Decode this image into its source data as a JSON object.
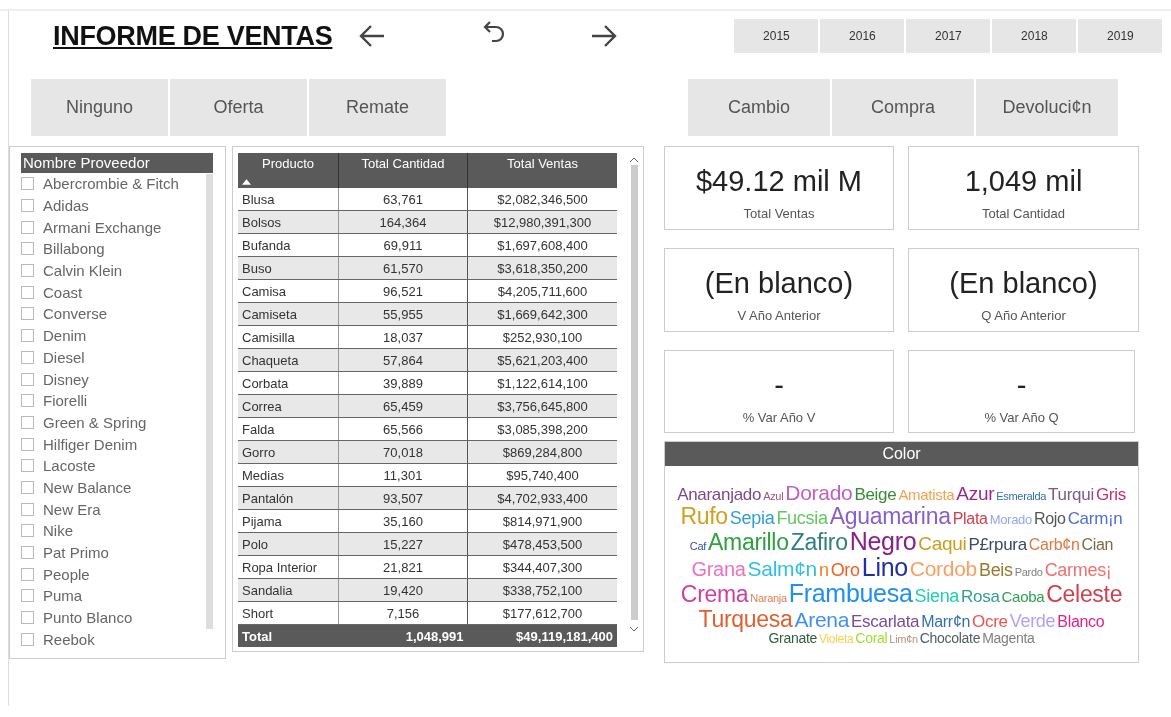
{
  "title": "INFORME DE VENTAS",
  "years": [
    {
      "label": "2015",
      "selected": false
    },
    {
      "label": "2016",
      "selected": false
    },
    {
      "label": "2017",
      "selected": false
    },
    {
      "label": "2018",
      "selected": false
    },
    {
      "label": "2019",
      "selected": false
    }
  ],
  "promo_buttons": [
    {
      "label": "Ninguno",
      "selected": false
    },
    {
      "label": "Oferta",
      "selected": false
    },
    {
      "label": "Remate",
      "selected": false
    }
  ],
  "type_buttons": [
    {
      "label": "Cambio",
      "selected": false
    },
    {
      "label": "Compra",
      "selected": false
    },
    {
      "label": "Devoluci¢n",
      "selected": false
    }
  ],
  "supplier_slicer": {
    "title": "Nombre Proveedor",
    "items": [
      {
        "label": "Abercrombie & Fitch",
        "checked": false
      },
      {
        "label": "Adidas",
        "checked": false
      },
      {
        "label": "Armani Exchange",
        "checked": false
      },
      {
        "label": "Billabong",
        "checked": false
      },
      {
        "label": "Calvin Klein",
        "checked": false
      },
      {
        "label": "Coast",
        "checked": false
      },
      {
        "label": "Converse",
        "checked": false
      },
      {
        "label": "Denim",
        "checked": false
      },
      {
        "label": "Diesel",
        "checked": false
      },
      {
        "label": "Disney",
        "checked": false
      },
      {
        "label": "Fiorelli",
        "checked": false
      },
      {
        "label": "Green & Spring",
        "checked": false
      },
      {
        "label": "Hilfiger Denim",
        "checked": false
      },
      {
        "label": "Lacoste",
        "checked": false
      },
      {
        "label": "New Balance",
        "checked": false
      },
      {
        "label": "New Era",
        "checked": false
      },
      {
        "label": "Nike",
        "checked": false
      },
      {
        "label": "Pat Primo",
        "checked": false
      },
      {
        "label": "People",
        "checked": false
      },
      {
        "label": "Puma",
        "checked": false
      },
      {
        "label": "Punto Blanco",
        "checked": false
      },
      {
        "label": "Reebok",
        "checked": false
      }
    ]
  },
  "table": {
    "columns": [
      "Producto",
      "Total Cantidad",
      "Total Ventas"
    ],
    "rows": [
      [
        "Blusa",
        "63,761",
        "$2,082,346,500"
      ],
      [
        "Bolsos",
        "164,364",
        "$12,980,391,300"
      ],
      [
        "Bufanda",
        "69,911",
        "$1,697,608,400"
      ],
      [
        "Buso",
        "61,570",
        "$3,618,350,200"
      ],
      [
        "Camisa",
        "96,521",
        "$4,205,711,600"
      ],
      [
        "Camiseta",
        "55,955",
        "$1,669,642,300"
      ],
      [
        "Camisilla",
        "18,037",
        "$252,930,100"
      ],
      [
        "Chaqueta",
        "57,864",
        "$5,621,203,400"
      ],
      [
        "Corbata",
        "39,889",
        "$1,122,614,100"
      ],
      [
        "Correa",
        "65,459",
        "$3,756,645,800"
      ],
      [
        "Falda",
        "65,566",
        "$3,085,398,200"
      ],
      [
        "Gorro",
        "70,018",
        "$869,284,800"
      ],
      [
        "Medias",
        "11,301",
        "$95,740,400"
      ],
      [
        "Pantalón",
        "93,507",
        "$4,702,933,400"
      ],
      [
        "Pijama",
        "35,160",
        "$814,971,900"
      ],
      [
        "Polo",
        "15,227",
        "$478,453,500"
      ],
      [
        "Ropa Interior",
        "21,821",
        "$344,407,300"
      ],
      [
        "Sandalia",
        "19,420",
        "$338,752,100"
      ],
      [
        "Short",
        "7,156",
        "$177,612,700"
      ]
    ],
    "total": [
      "Total",
      "1,048,991",
      "$49,119,181,400"
    ]
  },
  "kpi_cards": [
    {
      "value": "$49.12 mil M",
      "label": "Total Ventas"
    },
    {
      "value": "1,049 mil",
      "label": "Total Cantidad"
    },
    {
      "value": "(En blanco)",
      "label": "V Año Anterior"
    },
    {
      "value": "(En blanco)",
      "label": "Q Año Anterior"
    },
    {
      "value": "-",
      "label": "% Var Año V"
    },
    {
      "value": "-",
      "label": "% Var Año Q"
    }
  ],
  "word_cloud": {
    "title": "Color",
    "words": [
      {
        "text": "Anaranjado",
        "color": "#7a4a8a"
      },
      {
        "text": "Azul",
        "color": "#a0527a"
      },
      {
        "text": "Dorado",
        "color": "#c060c0"
      },
      {
        "text": "Beige",
        "color": "#3a8a3a"
      },
      {
        "text": "Amatista",
        "color": "#f5a050"
      },
      {
        "text": "Azur",
        "color": "#9a2a8a"
      },
      {
        "text": "Esmeralda",
        "color": "#3070b0"
      },
      {
        "text": "Turqui",
        "color": "#7a5a8a"
      },
      {
        "text": "Gris",
        "color": "#c03070"
      },
      {
        "text": "Rufo",
        "color": "#d0a020"
      },
      {
        "text": "Sepia",
        "color": "#30a0d0"
      },
      {
        "text": "Fucsia",
        "color": "#60c860"
      },
      {
        "text": "Aguamarina",
        "color": "#8a60c8"
      },
      {
        "text": "Plata",
        "color": "#d04050"
      },
      {
        "text": "Morado",
        "color": "#90a8f0"
      },
      {
        "text": "Rojo",
        "color": "#555555"
      },
      {
        "text": "Carm¡n",
        "color": "#5070d0"
      },
      {
        "text": "Caf",
        "color": "#3a50a0"
      },
      {
        "text": "Amarillo",
        "color": "#30a040"
      },
      {
        "text": "Zafiro",
        "color": "#308080"
      },
      {
        "text": "Negro",
        "color": "#8a208a"
      },
      {
        "text": "Caqui",
        "color": "#c8a020"
      },
      {
        "text": "P£rpura",
        "color": "#3a4a6a"
      },
      {
        "text": "Carb¢n",
        "color": "#e07840"
      },
      {
        "text": "Cian",
        "color": "#7a6a4a"
      },
      {
        "text": "Grana",
        "color": "#f070c0"
      },
      {
        "text": "Salm¢n",
        "color": "#30c0e0"
      },
      {
        "text": "n",
        "color": "#f08020"
      },
      {
        "text": "Oro",
        "color": "#f06020"
      },
      {
        "text": "Lino",
        "color": "#2030a0"
      },
      {
        "text": "Cordob",
        "color": "#f8a060"
      },
      {
        "text": "Beis",
        "color": "#9a7a30"
      },
      {
        "text": "Pardo",
        "color": "#808080"
      },
      {
        "text": "Carmes¡",
        "color": "#f07070"
      },
      {
        "text": "Crema",
        "color": "#d040a0"
      },
      {
        "text": "Naranja",
        "color": "#e08050"
      },
      {
        "text": "Frambuesa",
        "color": "#2090f0"
      },
      {
        "text": "Siena",
        "color": "#20d0b0"
      },
      {
        "text": "Rosa",
        "color": "#30a090"
      },
      {
        "text": "Caoba",
        "color": "#30a050"
      },
      {
        "text": "Celeste",
        "color": "#d04050"
      },
      {
        "text": "Turquesa",
        "color": "#e06030"
      },
      {
        "text": "Arena",
        "color": "#4090f0"
      },
      {
        "text": "Escarlata",
        "color": "#7a4a9a"
      },
      {
        "text": "Marr¢n",
        "color": "#3070b0"
      },
      {
        "text": "Ocre",
        "color": "#f05050"
      },
      {
        "text": "Verde",
        "color": "#b0a0f8"
      },
      {
        "text": "Blanco",
        "color": "#e02090"
      },
      {
        "text": "Granate",
        "color": "#306040"
      },
      {
        "text": "Violeta",
        "color": "#f8d050"
      },
      {
        "text": "Coral",
        "color": "#a0e030"
      },
      {
        "text": "Lim¢n",
        "color": "#c09080"
      },
      {
        "text": "Chocolate",
        "color": "#506060"
      },
      {
        "text": "Magenta",
        "color": "#808080"
      }
    ]
  }
}
